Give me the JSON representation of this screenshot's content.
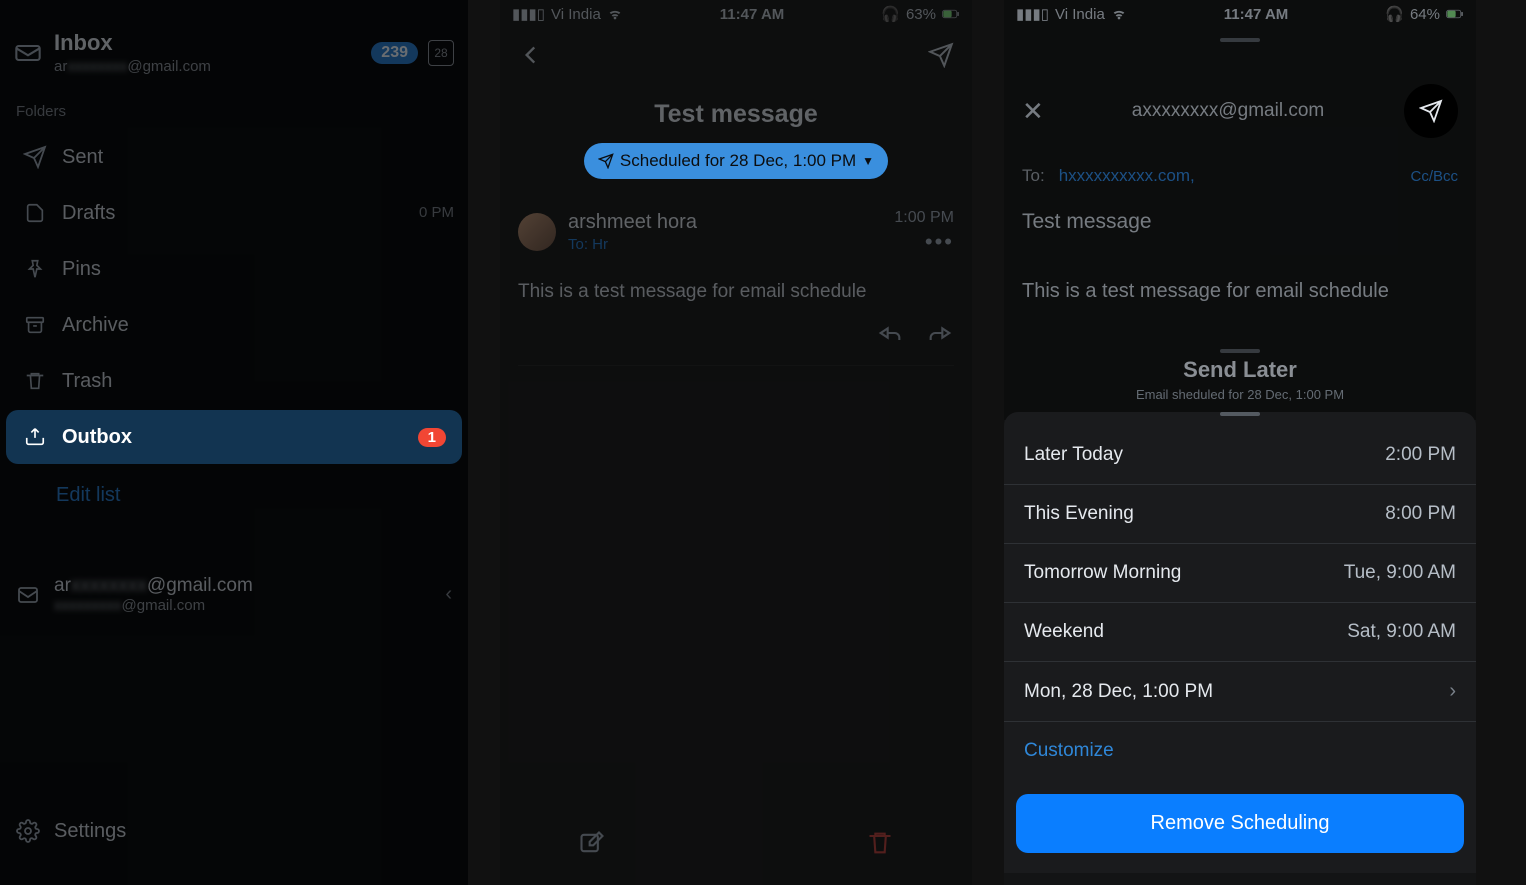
{
  "screen1": {
    "inbox": {
      "title": "Inbox",
      "subtitle_prefix": "ar",
      "subtitle_suffix": "@gmail.com",
      "badge": "239",
      "calendar": "28"
    },
    "folders_label": "Folders",
    "folders": [
      {
        "label": "Sent"
      },
      {
        "label": "Drafts",
        "time": "0 PM"
      },
      {
        "label": "Pins"
      },
      {
        "label": "Archive"
      },
      {
        "label": "Trash"
      },
      {
        "label": "Outbox",
        "badge": "1"
      }
    ],
    "edit_list": "Edit list",
    "account": {
      "line1_prefix": "ar",
      "line1_suffix": "@gmail.com",
      "line2_suffix": "@gmail.com"
    },
    "settings": "Settings"
  },
  "screen2": {
    "status": {
      "carrier": "Vi India",
      "time": "11:47 AM",
      "battery": "63%"
    },
    "title": "Test message",
    "scheduled_pill": "Scheduled for 28 Dec, 1:00 PM",
    "sender": "arshmeet hora",
    "to_line": "To: Hr",
    "sent_time": "1:00 PM",
    "body": "This is a test message for email schedule"
  },
  "screen3": {
    "status": {
      "carrier": "Vi India",
      "time": "11:47 AM",
      "battery": "64%"
    },
    "from_prefix": "a",
    "from_suffix": "@gmail.com",
    "to_label": "To:",
    "to_value": "h",
    "to_value_suffix": ".com,",
    "ccbcc": "Cc/Bcc",
    "subject": "Test message",
    "body": "This is a test message for email schedule",
    "send_later": {
      "title": "Send Later",
      "subtitle": "Email sheduled for 28 Dec, 1:00 PM"
    },
    "options": [
      {
        "label": "Later Today",
        "time": "2:00 PM"
      },
      {
        "label": "This Evening",
        "time": "8:00 PM"
      },
      {
        "label": "Tomorrow Morning",
        "time": "Tue, 9:00 AM"
      },
      {
        "label": "Weekend",
        "time": "Sat, 9:00 AM"
      },
      {
        "label": "Mon, 28 Dec, 1:00 PM",
        "time": "",
        "chevron": true
      }
    ],
    "customize": "Customize",
    "remove": "Remove Scheduling"
  }
}
